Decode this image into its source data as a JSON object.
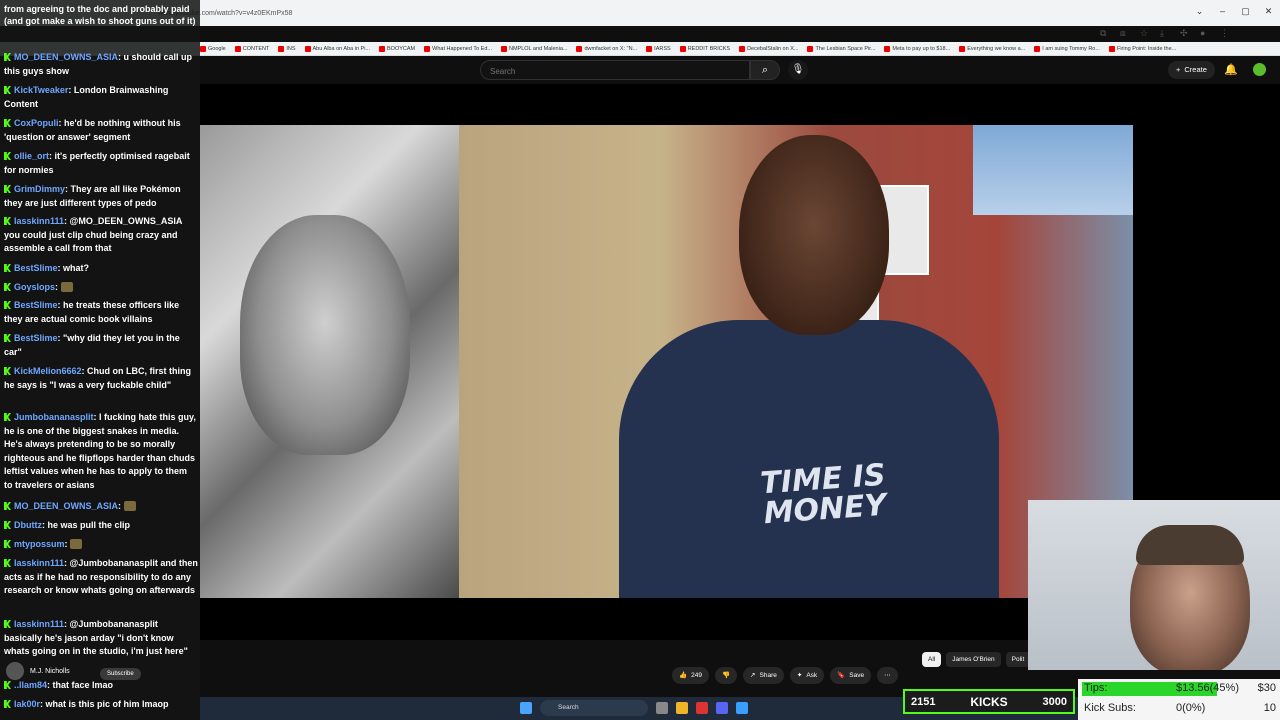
{
  "browser": {
    "url": "www.youtube.com/watch?v=v4z0EKmPx58",
    "bookmarks": [
      {
        "label": "Google"
      },
      {
        "label": "CONTENT"
      },
      {
        "label": "INS"
      },
      {
        "label": "Abu Alba on Aba in Pi..."
      },
      {
        "label": "BOOYCAM"
      },
      {
        "label": "What Happened To Ed..."
      },
      {
        "label": "NMPLOL and Malenia..."
      },
      {
        "label": "dwmfacket on X: \"N..."
      },
      {
        "label": "IARSS"
      },
      {
        "label": "REDDIT BRICKS"
      },
      {
        "label": "DecebalStalin on X..."
      },
      {
        "label": "The Lesbian Space Pir..."
      },
      {
        "label": "Meta to pay up to $18..."
      },
      {
        "label": "Everything we know a..."
      },
      {
        "label": "I am suing Tommy Ro..."
      },
      {
        "label": "Firing Point: Inside the..."
      }
    ]
  },
  "youtube": {
    "search_placeholder": "Search",
    "create_label": "Create",
    "channel_name": "M.J. Nicholls",
    "subscribe_label": "Subscribe",
    "actions": [
      {
        "label": "249",
        "icon": "like-icon"
      },
      {
        "label": "",
        "icon": "dislike-icon"
      },
      {
        "label": "Share",
        "icon": "share-icon"
      },
      {
        "label": "Ask",
        "icon": "sparkle-icon"
      },
      {
        "label": "Save",
        "icon": "bookmark-icon"
      },
      {
        "label": "...",
        "icon": "more-icon"
      }
    ],
    "chips": [
      {
        "label": "All",
        "active": true
      },
      {
        "label": "James O'Brien",
        "active": false
      },
      {
        "label": "Polit",
        "active": false
      }
    ],
    "shirt_text": "TIME IS MONEY"
  },
  "chat": {
    "top_text": "from agreeing to the doc and probably paid (and got make a wish to shoot guns out of it)",
    "messages": [
      {
        "user": "MO_DEEN_OWNS_ASIA",
        "text": "u should call up this guys show"
      },
      {
        "user": "KickTweaker",
        "text": "London Brainwashing Content"
      },
      {
        "user": "CoxPopuli",
        "text": "he'd be nothing without his 'question or answer' segment"
      },
      {
        "user": "ollie_ort",
        "text": "it's perfectly optimised ragebait for normies"
      },
      {
        "user": "GrimDimmy",
        "text": "They are all like Pokémon they are just different types of pedo"
      },
      {
        "user": "lasskinn111",
        "text": "@MO_DEEN_OWNS_ASIA you could just clip chud being crazy and assemble a call from that"
      },
      {
        "user": "BestSlime",
        "text": "what?"
      },
      {
        "user": "Goyslops",
        "text": ""
      },
      {
        "user": "BestSlime",
        "text": "he treats these officers like they are actual comic book villains"
      },
      {
        "user": "BestSlime",
        "text": "\"why did they let you in the car\""
      },
      {
        "user": "KickMelion6662",
        "text": "Chud on LBC, first thing he says is \"I was a very fuckable child\""
      },
      {
        "user": "Jumbobananasplit",
        "text": "I fucking hate this guy, he is one of the biggest snakes in media. He's always pretending to be so morally righteous and he flipflops harder than chuds leftist values when he has to apply to them to travelers or asians"
      },
      {
        "user": "MO_DEEN_OWNS_ASIA",
        "text": ""
      },
      {
        "user": "Dbuttz",
        "text": "he was pull the clip"
      },
      {
        "user": "mtypossum",
        "text": ""
      },
      {
        "user": "lasskinn111",
        "text": "@Jumbobananasplit and then acts as if he had no responsibility to do any research or know whats going on afterwards"
      },
      {
        "user": "lasskinn111",
        "text": "@Jumbobananasplit basically he's jason arday \"i don't know whats going on in the studio, i'm just here\""
      },
      {
        "user": "..llam84",
        "text": "that face lmao"
      },
      {
        "user": "lak00r",
        "text": "what is this pic of him lmaop"
      }
    ]
  },
  "taskbar": {
    "search_label": "Search"
  },
  "overlay": {
    "kicks_count": "2151",
    "kicks_label": "KICKS",
    "kicks_goal": "3000",
    "tips_label": "Tips:",
    "tips_value": "$13.56(45%)",
    "tips_goal": "$30",
    "tips_fraction": 0.45,
    "kick_subs_label": "Kick Subs:",
    "kick_subs_value": "0(0%)",
    "kick_subs_goal": "10"
  },
  "colors": {
    "kick_green": "#53fc18",
    "username_blue": "#6fa7ff",
    "yt_bg": "#0f0f0f"
  }
}
